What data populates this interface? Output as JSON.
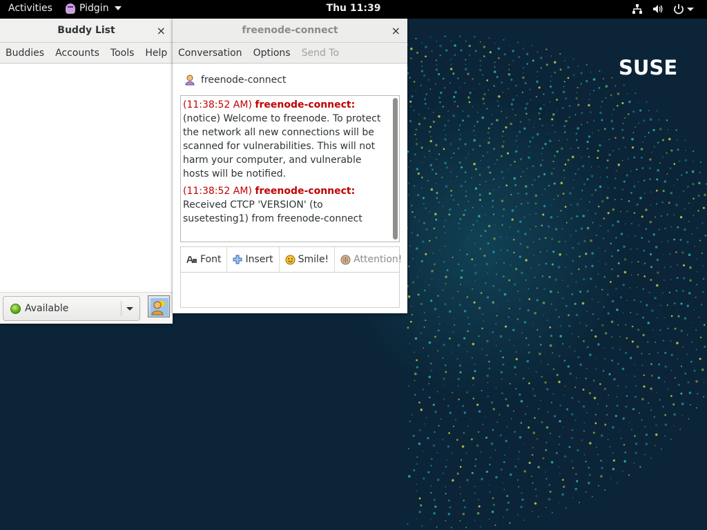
{
  "topbar": {
    "activities": "Activities",
    "app_name": "Pidgin",
    "clock": "Thu 11:39",
    "tray_icons": [
      "network-icon",
      "volume-icon",
      "power-icon"
    ]
  },
  "desktop": {
    "brand": "SUSE",
    "colors": {
      "background": "#0b2437",
      "dots": "#1fa7a0",
      "logo_green": "#30ba78"
    }
  },
  "buddy_window": {
    "title": "Buddy List",
    "close": "×",
    "menu": [
      "Buddies",
      "Accounts",
      "Tools",
      "Help"
    ],
    "status": "Available"
  },
  "conversation_window": {
    "title": "freenode-connect",
    "close": "×",
    "menu": [
      "Conversation",
      "Options",
      "Send To"
    ],
    "contact": "freenode-connect",
    "messages": [
      {
        "time": "(11:38:52 AM)",
        "nick": "freenode-connect:",
        "text": "(notice) Welcome to freenode. To protect the network all new connections will be scanned for vulnerabilities. This will not harm your computer, and vulnerable hosts will be notified."
      },
      {
        "time": "(11:38:52 AM)",
        "nick": "freenode-connect:",
        "text": "Received CTCP 'VERSION' (to susetesting1) from freenode-connect"
      }
    ],
    "toolbar": {
      "font": "Font",
      "insert": "Insert",
      "smile": "Smile!",
      "attention": "Attention!"
    }
  }
}
